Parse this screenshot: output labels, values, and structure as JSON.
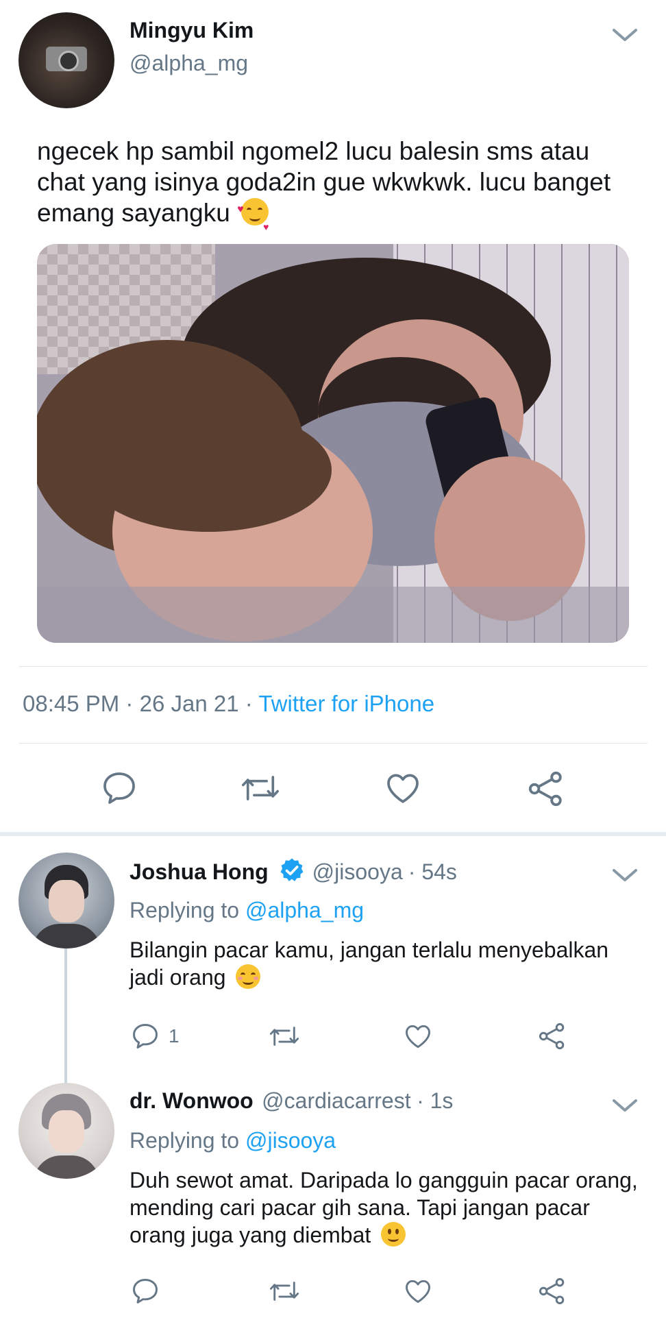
{
  "main_tweet": {
    "author_name": "Mingyu Kim",
    "author_handle": "@alpha_mg",
    "text": "ngecek hp sambil ngomel2 lucu balesin sms atau chat yang isinya goda2in gue wkwkwk. lucu banget emang sayangku",
    "emoji": "smiling-face-with-hearts",
    "time": "08:45 PM",
    "dot": "·",
    "date": "26 Jan 21",
    "source": "Twitter for iPhone"
  },
  "replies": [
    {
      "author_name": "Joshua Hong",
      "verified": true,
      "author_handle": "@jisooya",
      "time_ago": "· 54s",
      "replying_label": "Replying to",
      "replying_to": "@alpha_mg",
      "text": "Bilangin pacar kamu, jangan terlalu menyebalkan jadi orang",
      "emoji": "smiling-face",
      "reply_count": "1"
    },
    {
      "author_name": "dr. Wonwoo",
      "verified": false,
      "author_handle": "@cardiacarrest",
      "time_ago": "· 1s",
      "replying_label": "Replying to",
      "replying_to": "@jisooya",
      "text": "Duh sewot amat. Daripada lo gangguin pacar orang, mending cari pacar gih sana. Tapi jangan pacar orang juga yang diembat",
      "emoji": "slightly-smiling-face",
      "reply_count": ""
    }
  ],
  "colors": {
    "accent": "#1da1f2",
    "verified": "#1da1f2",
    "text": "#14171a",
    "muted": "#657786",
    "icon": "#657786"
  }
}
